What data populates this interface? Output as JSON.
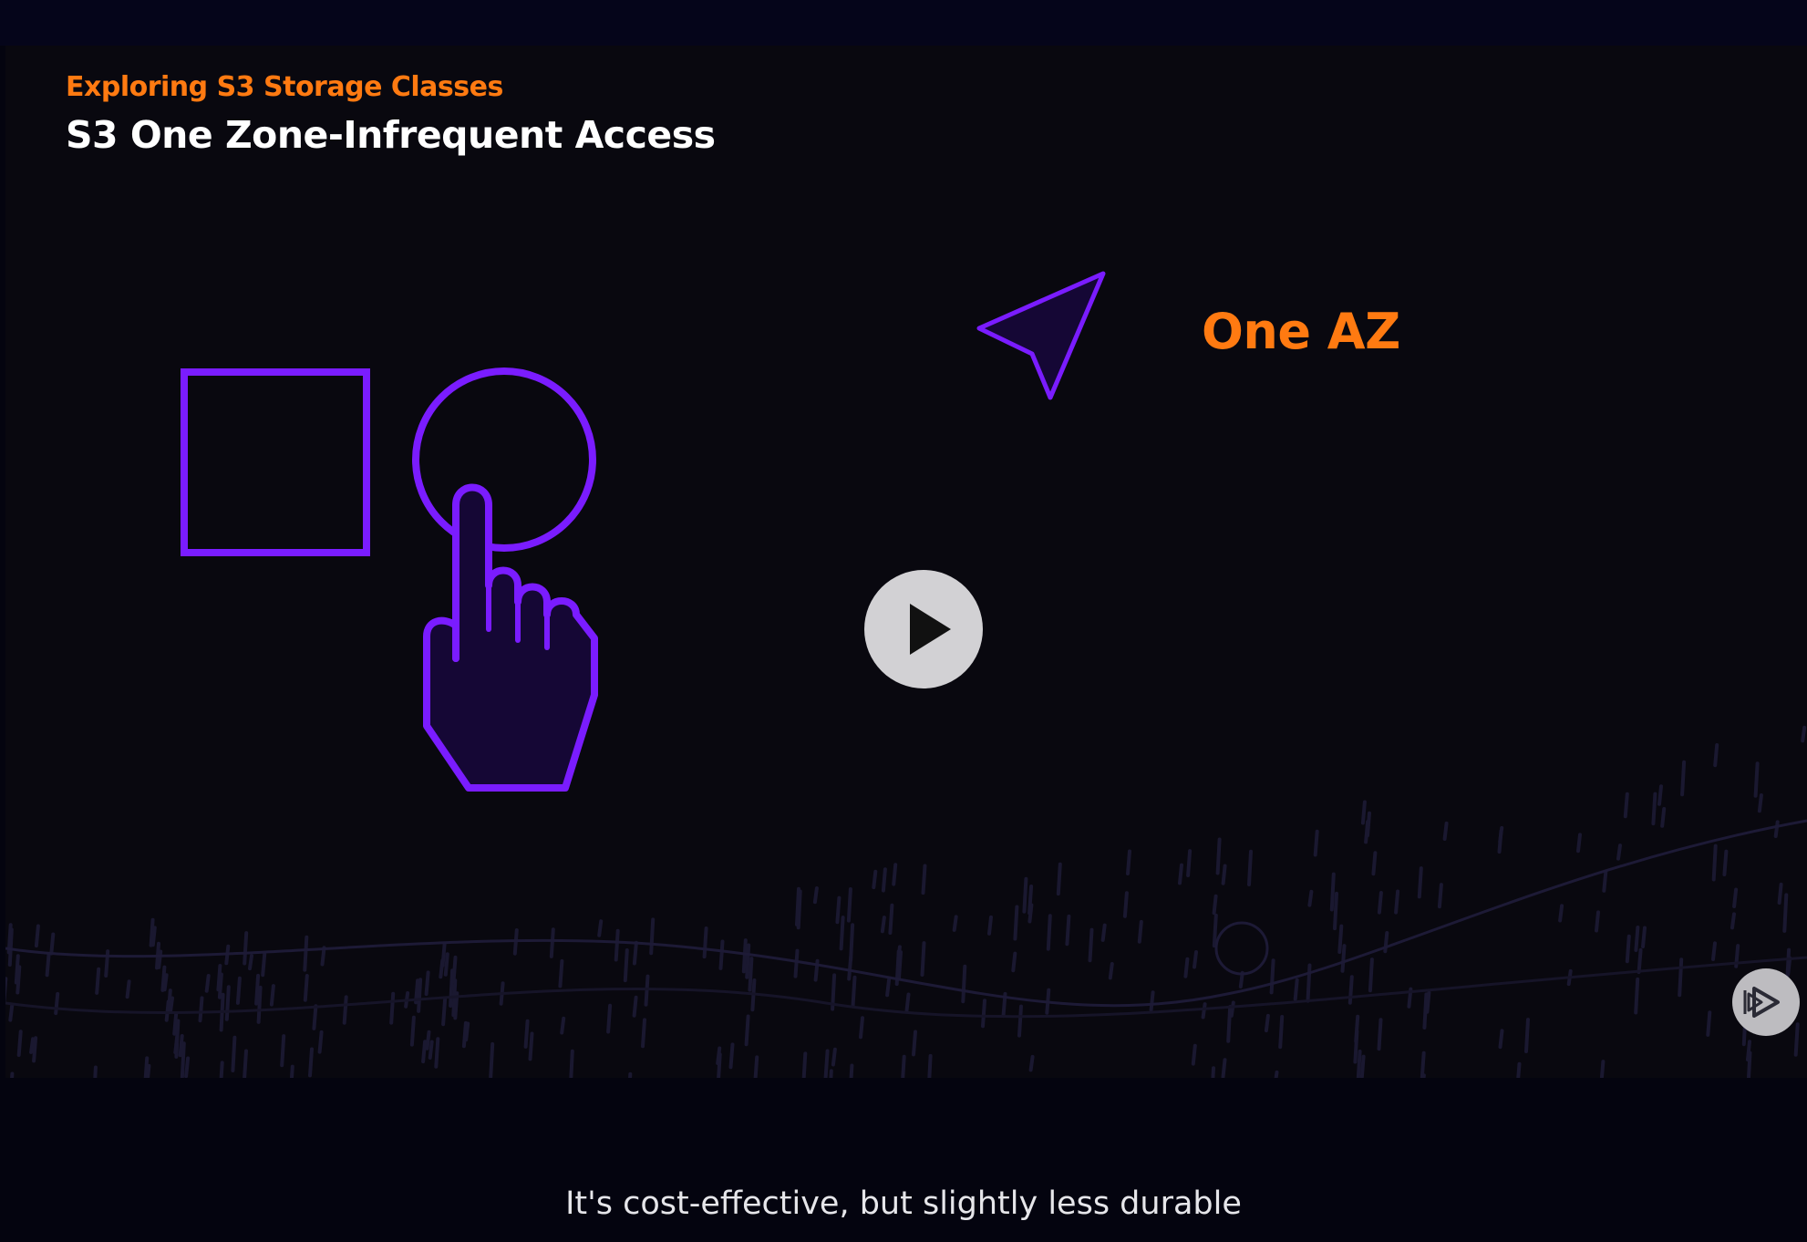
{
  "slide": {
    "subtitle": "Exploring S3 Storage Classes",
    "title": "S3 One Zone-Infrequent Access",
    "callout": "One AZ"
  },
  "caption": {
    "text": "It's cost-effective, but slightly less durable"
  },
  "icons": {
    "square": "square-outline-icon",
    "hand": "hand-pointer-icon",
    "arrow": "cursor-arrow-icon",
    "play": "play-icon",
    "brand": "pluralsight-logo-icon"
  },
  "colors": {
    "accent_orange": "#ff7a11",
    "illustration_purple": "#7a1cff",
    "background": "#09080f",
    "play_button": "#d2d1d4"
  }
}
